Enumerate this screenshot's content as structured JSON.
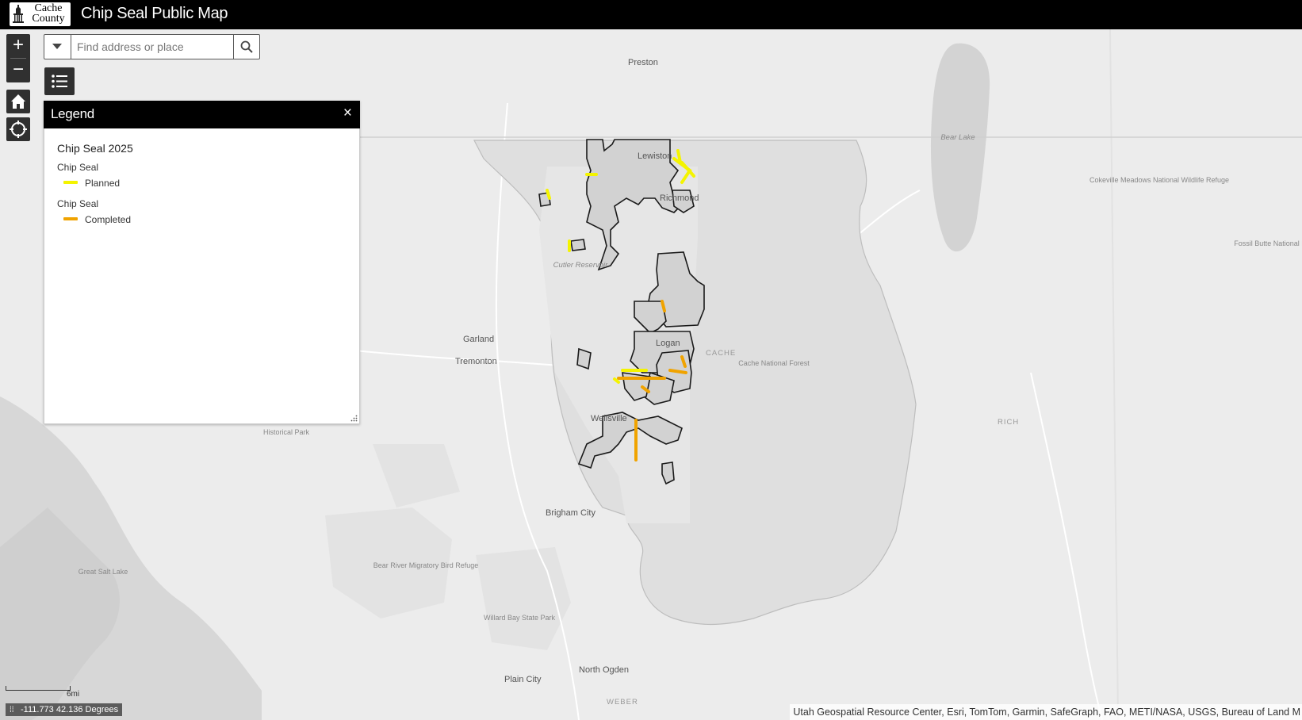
{
  "header": {
    "logo_text": "Cache\nCounty",
    "title": "Chip Seal Public Map"
  },
  "search": {
    "placeholder": "Find address or place"
  },
  "legend": {
    "title": "Legend",
    "close": "×",
    "layer_title": "Chip Seal 2025",
    "items": [
      {
        "group": "Chip Seal",
        "label": "Planned",
        "color": "#f4f400"
      },
      {
        "group": "Chip Seal",
        "label": "Completed",
        "color": "#f0a300"
      }
    ]
  },
  "map": {
    "places": [
      {
        "name": "Preston"
      },
      {
        "name": "Lewiston"
      },
      {
        "name": "Richmond"
      },
      {
        "name": "Logan"
      },
      {
        "name": "Wellsville"
      },
      {
        "name": "Garland"
      },
      {
        "name": "Tremonton"
      },
      {
        "name": "Brigham City"
      },
      {
        "name": "Plain City"
      },
      {
        "name": "North Ogden"
      }
    ],
    "features": [
      {
        "name": "Bear Lake"
      },
      {
        "name": "Cutler Reservoir"
      },
      {
        "name": "Cache National Forest"
      },
      {
        "name": "Cokeville Meadows National Wildlife Refuge"
      },
      {
        "name": "Fossil Butte National Monument"
      },
      {
        "name": "Historical Park"
      },
      {
        "name": "Great Salt Lake"
      },
      {
        "name": "Bear River Migratory Bird Refuge"
      },
      {
        "name": "Willard Bay State Park"
      }
    ],
    "counties": [
      "CACHE",
      "RICH",
      "WEBER"
    ]
  },
  "scale": {
    "label": "6mi"
  },
  "coordinates": {
    "text": "-111.773 42.136 Degrees"
  },
  "attribution": "Utah Geospatial Resource Center, Esri, TomTom, Garmin, SafeGraph, FAO, METI/NASA, USGS, Bureau of Land M",
  "colors": {
    "planned": "#f4f400",
    "completed": "#f0a300",
    "header": "#000000",
    "widget": "#303030"
  }
}
